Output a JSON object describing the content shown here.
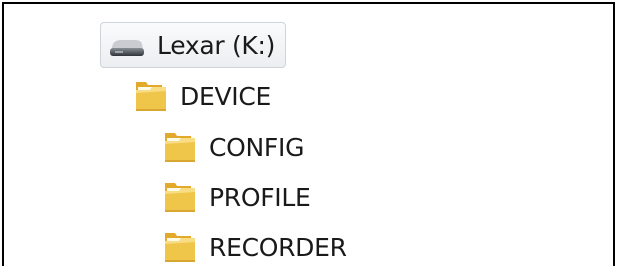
{
  "tree": {
    "drive": {
      "label": "Lexar (K:)",
      "icon": "usb-drive-icon"
    },
    "folders": [
      {
        "label": "DEVICE",
        "icon": "folder-icon"
      },
      {
        "label": "CONFIG",
        "icon": "folder-icon"
      },
      {
        "label": "PROFILE",
        "icon": "folder-icon"
      },
      {
        "label": "RECORDER",
        "icon": "folder-icon"
      }
    ]
  },
  "colors": {
    "selection_border": "#cfd4da",
    "folder_yellow": "#f0c64a",
    "text": "#1a1a1a",
    "frame": "#000000"
  }
}
